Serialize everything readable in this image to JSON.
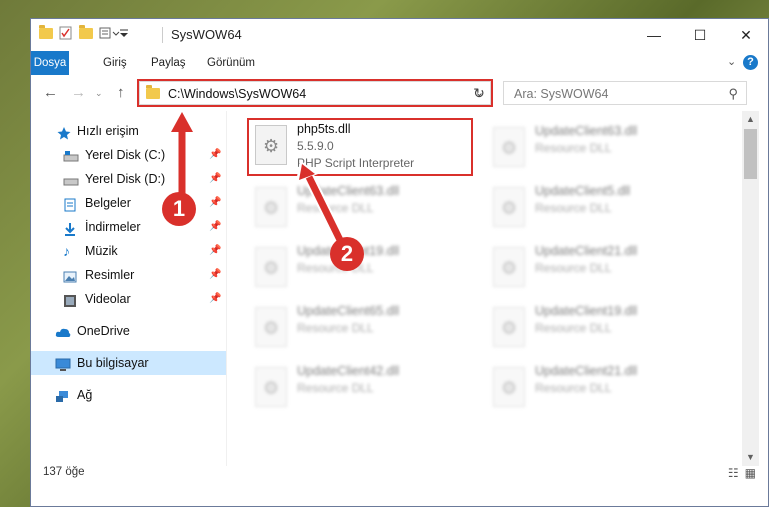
{
  "window": {
    "title": "SysWOW64",
    "controls": {
      "minimize": "—",
      "maximize": "☐",
      "close": "✕"
    }
  },
  "ribbon": {
    "tabs": [
      "Dosya",
      "Giriş",
      "Paylaş",
      "Görünüm"
    ],
    "expand": "⌄",
    "help": "?"
  },
  "nav": {
    "address": "C:\\Windows\\SysWOW64",
    "search_placeholder": "Ara: SysWOW64"
  },
  "sidebar": {
    "items": [
      {
        "label": "Hızlı erişim",
        "icon": "star-icon"
      },
      {
        "label": "Yerel Disk (C:)",
        "icon": "drive-icon",
        "pinned": true
      },
      {
        "label": "Yerel Disk (D:)",
        "icon": "drive-icon",
        "pinned": true
      },
      {
        "label": "Belgeler",
        "icon": "documents-icon",
        "pinned": true
      },
      {
        "label": "İndirmeler",
        "icon": "download-icon",
        "pinned": true
      },
      {
        "label": "Müzik",
        "icon": "music-icon",
        "pinned": true
      },
      {
        "label": "Resimler",
        "icon": "pictures-icon",
        "pinned": true
      },
      {
        "label": "Videolar",
        "icon": "video-icon",
        "pinned": true
      },
      {
        "label": "OneDrive",
        "icon": "cloud-icon"
      },
      {
        "label": "Bu bilgisayar",
        "icon": "computer-icon",
        "selected": true
      },
      {
        "label": "Ağ",
        "icon": "network-icon"
      }
    ]
  },
  "files": {
    "selected": {
      "name": "php5ts.dll",
      "version": "5.5.9.0",
      "description": "PHP Script Interpreter"
    },
    "left": [
      {
        "name": "UpdateClient63.dll",
        "type": "Resource DLL"
      },
      {
        "name": "UpdateClient19.dll",
        "type": "Resource DLL"
      },
      {
        "name": "UpdateClient65.dll",
        "type": "Resource DLL"
      },
      {
        "name": "UpdateClient42.dll",
        "type": "Resource DLL"
      }
    ],
    "right": [
      {
        "name": "UpdateClient63.dll",
        "type": "Resource DLL"
      },
      {
        "name": "UpdateClient5.dll",
        "type": "Resource DLL"
      },
      {
        "name": "UpdateClient21.dll",
        "type": "Resource DLL"
      },
      {
        "name": "UpdateClient19.dll",
        "type": "Resource DLL"
      },
      {
        "name": "UpdateClient21.dll",
        "type": "Resource DLL"
      }
    ]
  },
  "status": {
    "count": "137 öğe"
  },
  "callouts": [
    "1",
    "2"
  ],
  "colors": {
    "accent": "#1979ca",
    "highlight": "#d9302b",
    "selected_bg": "#cce8ff"
  }
}
